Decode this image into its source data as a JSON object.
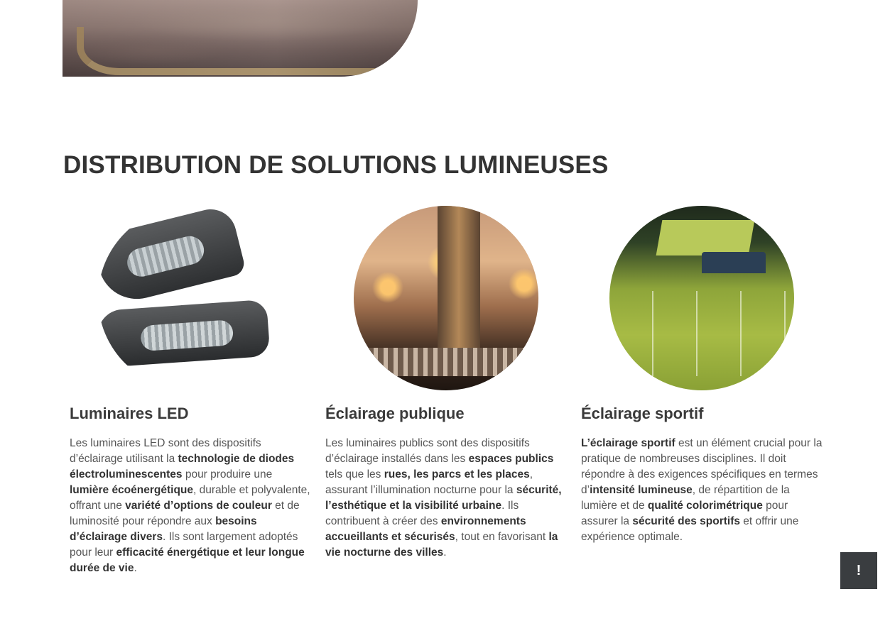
{
  "section": {
    "title": "DISTRIBUTION DE SOLUTIONS LUMINEUSES"
  },
  "columns": [
    {
      "title": "Luminaires LED",
      "text": [
        {
          "t": "Les luminaires LED sont des dispositifs d’éclairage utilisant la ",
          "b": false
        },
        {
          "t": "technologie de diodes électroluminescentes",
          "b": true
        },
        {
          "t": " pour produire une ",
          "b": false
        },
        {
          "t": "lumière écoénergétique",
          "b": true
        },
        {
          "t": ", durable et polyvalente, offrant une ",
          "b": false
        },
        {
          "t": "variété d’options de couleur",
          "b": true
        },
        {
          "t": " et de luminosité pour répondre aux ",
          "b": false
        },
        {
          "t": "besoins d’éclairage divers",
          "b": true
        },
        {
          "t": ". Ils sont largement adoptés pour leur ",
          "b": false
        },
        {
          "t": "efficacité énergétique et leur longue durée de vie",
          "b": true
        },
        {
          "t": ".",
          "b": false
        }
      ]
    },
    {
      "title": "Éclairage publique",
      "text": [
        {
          "t": "Les luminaires publics sont des dispositifs d’éclairage installés dans les ",
          "b": false
        },
        {
          "t": "espaces publics",
          "b": true
        },
        {
          "t": " tels que les ",
          "b": false
        },
        {
          "t": "rues, les parcs et les places",
          "b": true
        },
        {
          "t": ", assurant l’illumination nocturne pour la ",
          "b": false
        },
        {
          "t": "sécurité, l’esthétique et la visibilité urbaine",
          "b": true
        },
        {
          "t": ". Ils contribuent à créer des ",
          "b": false
        },
        {
          "t": "environnements accueillants et sécurisés",
          "b": true
        },
        {
          "t": ", tout en favorisant ",
          "b": false
        },
        {
          "t": "la vie nocturne des villes",
          "b": true
        },
        {
          "t": ".",
          "b": false
        }
      ]
    },
    {
      "title": "Éclairage sportif",
      "text": [
        {
          "t": "L’éclairage sportif",
          "b": true
        },
        {
          "t": " est un élément crucial pour la pratique de nombreuses disciplines. Il doit répondre à des exigences spécifiques en termes d’",
          "b": false
        },
        {
          "t": "intensité lumineuse",
          "b": true
        },
        {
          "t": ", de répartition de la lumière et de ",
          "b": false
        },
        {
          "t": "qualité colorimétrique",
          "b": true
        },
        {
          "t": " pour assurer la ",
          "b": false
        },
        {
          "t": "sécurité des sportifs",
          "b": true
        },
        {
          "t": " et offrir une expérience optimale.",
          "b": false
        }
      ]
    }
  ],
  "chat_button": {
    "label": "!"
  }
}
